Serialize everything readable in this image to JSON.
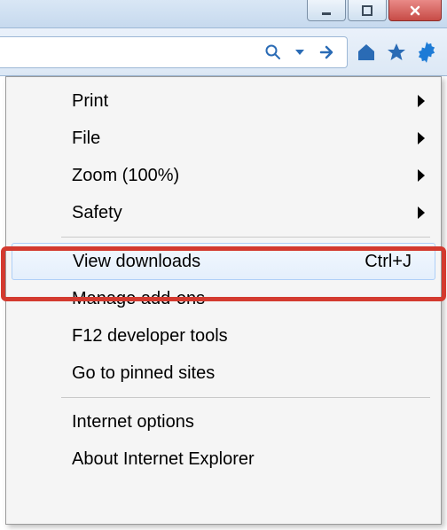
{
  "window": {
    "min_tooltip": "Minimize",
    "max_tooltip": "Maximize",
    "close_tooltip": "Close"
  },
  "toolbar": {
    "search_label": "Search",
    "go_label": "Go",
    "home_label": "Home",
    "favorites_label": "Favorites",
    "tools_label": "Tools"
  },
  "menu": {
    "print": "Print",
    "file": "File",
    "zoom": "Zoom (100%)",
    "safety": "Safety",
    "view_downloads": "View downloads",
    "view_downloads_shortcut": "Ctrl+J",
    "manage_addons": "Manage add-ons",
    "f12": "F12 developer tools",
    "pinned": "Go to pinned sites",
    "internet_options": "Internet options",
    "about": "About Internet Explorer"
  }
}
